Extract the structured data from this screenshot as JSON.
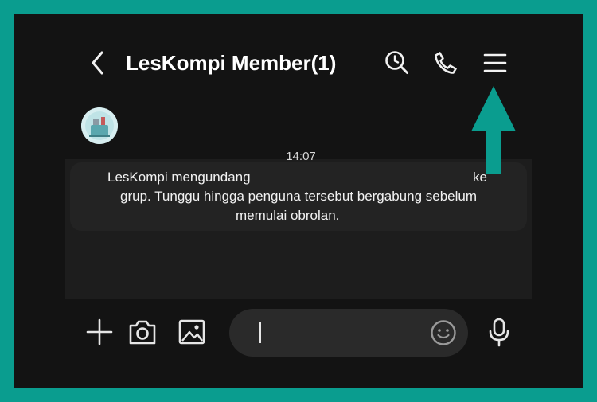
{
  "header": {
    "title": "LesKompi Member(1)",
    "back_icon": "chevron-left-icon",
    "search_icon": "clock-search-icon",
    "call_icon": "phone-icon",
    "menu_icon": "hamburger-menu-icon"
  },
  "chat": {
    "timestamp": "14:07",
    "system_message": {
      "line1_start": "LesKompi mengundang",
      "line1_end": "ke",
      "line2": "grup. Tunggu hingga penguna tersebut bergabung sebelum",
      "line3": "memulai obrolan."
    }
  },
  "composer": {
    "plus_icon": "plus-icon",
    "camera_icon": "camera-icon",
    "gallery_icon": "image-icon",
    "emoji_icon": "smiley-icon",
    "mic_icon": "microphone-icon",
    "input_value": ""
  },
  "colors": {
    "frame": "#0a9d8f",
    "background": "#131313",
    "panel": "#1d1d1d",
    "bubble": "#232323",
    "input": "#2a2a2a",
    "arrow": "#0a9d8f",
    "text": "#ffffff"
  }
}
